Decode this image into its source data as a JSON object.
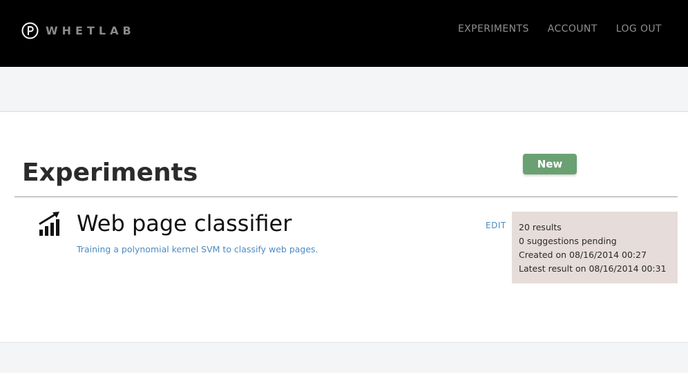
{
  "header": {
    "brand": "WHETLAB",
    "nav": [
      "EXPERIMENTS",
      "ACCOUNT",
      "LOG OUT"
    ]
  },
  "page": {
    "title": "Experiments",
    "new_label": "New"
  },
  "experiment": {
    "icon": "bar-chart-trend-icon",
    "title": "Web page classifier",
    "description": "Training a polynomial kernel SVM to classify web pages.",
    "edit_label": "EDIT",
    "stats": [
      "20 results",
      "0 suggestions pending",
      "Created on 08/16/2014 00:27",
      "Latest result on 08/16/2014 00:31"
    ]
  },
  "colors": {
    "header_bg": "#000000",
    "accent_green": "#6aa172",
    "link_blue": "#4a8bc2",
    "stats_bg": "#e6dcd9"
  }
}
